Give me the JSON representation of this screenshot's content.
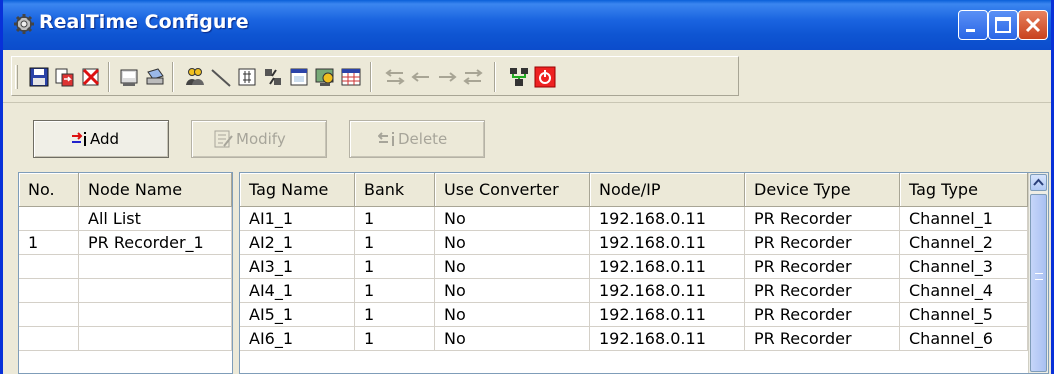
{
  "window": {
    "title": "RealTime Configure",
    "icon": "gear-icon",
    "controls": [
      "minimize-icon",
      "maximize-icon",
      "close-icon"
    ]
  },
  "toolbar": {
    "buttons": [
      {
        "name": "save-icon"
      },
      {
        "name": "export-icon"
      },
      {
        "name": "delete-file-icon"
      },
      {
        "name": "print-preview-icon"
      },
      {
        "name": "print-icon"
      },
      {
        "name": "user-group-icon"
      },
      {
        "name": "line-tool-icon"
      },
      {
        "name": "tag-list-icon"
      },
      {
        "name": "settings-icon"
      },
      {
        "name": "window-icon"
      },
      {
        "name": "display-icon"
      },
      {
        "name": "table-icon"
      },
      {
        "name": "move-all-left-icon",
        "disabled": true
      },
      {
        "name": "move-left-icon",
        "disabled": true
      },
      {
        "name": "move-right-icon",
        "disabled": true
      },
      {
        "name": "move-all-right-icon",
        "disabled": true
      },
      {
        "name": "network-icon"
      },
      {
        "name": "exit-icon"
      }
    ]
  },
  "actions": {
    "add_label": "Add",
    "modify_label": "Modify",
    "delete_label": "Delete"
  },
  "node_table": {
    "columns": [
      "No.",
      "Node Name"
    ],
    "rows": [
      [
        "",
        "All List"
      ],
      [
        "1",
        "PR Recorder_1"
      ],
      [
        "",
        ""
      ],
      [
        "",
        ""
      ],
      [
        "",
        ""
      ],
      [
        "",
        ""
      ]
    ]
  },
  "tag_table": {
    "columns": [
      "Tag Name",
      "Bank",
      "Use Converter",
      "Node/IP",
      "Device Type",
      "Tag Type"
    ],
    "rows": [
      [
        "AI1_1",
        "1",
        "No",
        "192.168.0.11",
        "PR Recorder",
        "Channel_1"
      ],
      [
        "AI2_1",
        "1",
        "No",
        "192.168.0.11",
        "PR Recorder",
        "Channel_2"
      ],
      [
        "AI3_1",
        "1",
        "No",
        "192.168.0.11",
        "PR Recorder",
        "Channel_3"
      ],
      [
        "AI4_1",
        "1",
        "No",
        "192.168.0.11",
        "PR Recorder",
        "Channel_4"
      ],
      [
        "AI5_1",
        "1",
        "No",
        "192.168.0.11",
        "PR Recorder",
        "Channel_5"
      ],
      [
        "AI6_1",
        "1",
        "No",
        "192.168.0.11",
        "PR Recorder",
        "Channel_6"
      ]
    ]
  },
  "colors": {
    "titlebar": "#0b4ccc",
    "window_bg": "#ece9d8",
    "grid_line": "#d4d0c8",
    "scrollbar": "#a9c0f2"
  }
}
